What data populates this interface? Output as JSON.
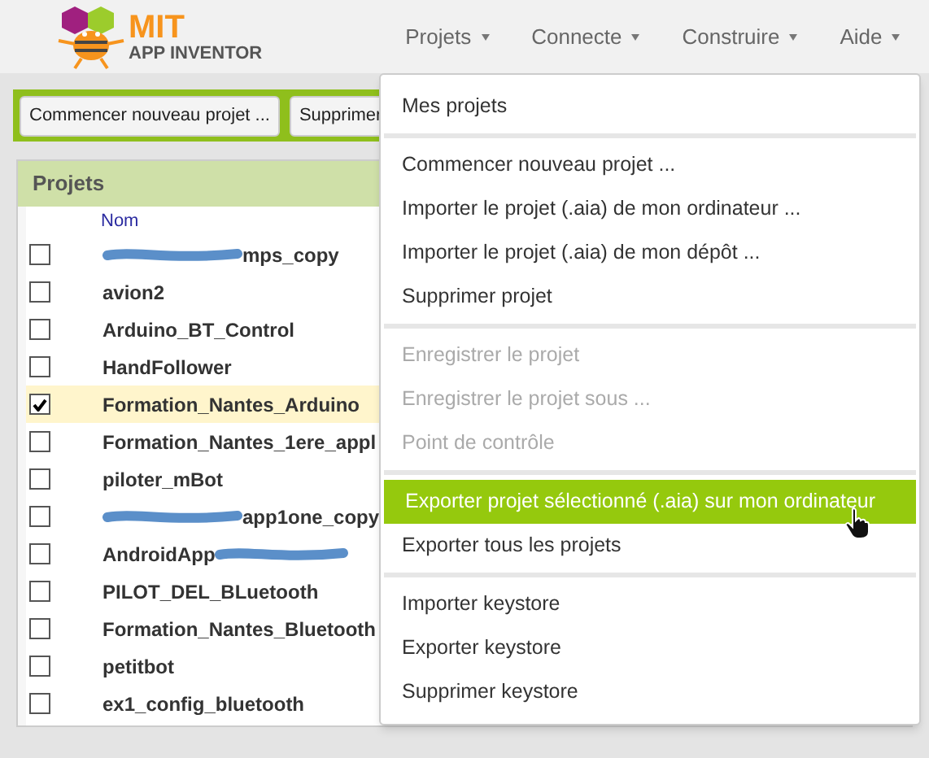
{
  "header": {
    "logo": {
      "title": "MIT",
      "subtitle": "APP INVENTOR"
    },
    "menus": [
      {
        "label": "Projets"
      },
      {
        "label": "Connecte"
      },
      {
        "label": "Construire"
      },
      {
        "label": "Aide"
      }
    ]
  },
  "toolbar": {
    "buttons": [
      "Commencer nouveau projet ...",
      "Supprimer"
    ]
  },
  "projects": {
    "title": "Projets",
    "column": "Nom",
    "rows": [
      {
        "name": "mps_copy",
        "checked": false,
        "kind": "redacted_start"
      },
      {
        "name": "avion2",
        "checked": false,
        "kind": "plain"
      },
      {
        "name": "Arduino_BT_Control",
        "checked": false,
        "kind": "plain"
      },
      {
        "name": "HandFollower",
        "checked": false,
        "kind": "plain"
      },
      {
        "name": "Formation_Nantes_Arduino",
        "checked": true,
        "kind": "plain"
      },
      {
        "name": "Formation_Nantes_1ere_appl",
        "checked": false,
        "kind": "plain"
      },
      {
        "name": "piloter_mBot",
        "checked": false,
        "kind": "plain"
      },
      {
        "name": "app1one_copy",
        "checked": false,
        "kind": "redacted_start"
      },
      {
        "name": "AndroidApp",
        "checked": false,
        "kind": "redacted_end"
      },
      {
        "name": "PILOT_DEL_BLuetooth",
        "checked": false,
        "kind": "plain"
      },
      {
        "name": "Formation_Nantes_Bluetooth",
        "checked": false,
        "kind": "plain"
      },
      {
        "name": "petitbot",
        "checked": false,
        "kind": "plain"
      },
      {
        "name": "ex1_config_bluetooth",
        "checked": false,
        "kind": "plain"
      }
    ]
  },
  "dropdown": {
    "groups": [
      [
        {
          "label": "Mes projets",
          "disabled": false,
          "selected": false
        }
      ],
      [
        {
          "label": "Commencer nouveau projet ...",
          "disabled": false,
          "selected": false
        },
        {
          "label": "Importer le projet (.aia) de mon ordinateur ...",
          "disabled": false,
          "selected": false
        },
        {
          "label": "Importer le projet (.aia) de mon dépôt ...",
          "disabled": false,
          "selected": false
        },
        {
          "label": "Supprimer projet",
          "disabled": false,
          "selected": false
        }
      ],
      [
        {
          "label": "Enregistrer le projet",
          "disabled": true,
          "selected": false
        },
        {
          "label": "Enregistrer le projet sous ...",
          "disabled": true,
          "selected": false
        },
        {
          "label": "Point de contrôle",
          "disabled": true,
          "selected": false
        }
      ],
      [
        {
          "label": "Exporter projet sélectionné (.aia) sur mon ordinateur",
          "disabled": false,
          "selected": true
        },
        {
          "label": "Exporter tous les projets",
          "disabled": false,
          "selected": false
        }
      ],
      [
        {
          "label": "Importer keystore",
          "disabled": false,
          "selected": false
        },
        {
          "label": "Exporter keystore",
          "disabled": false,
          "selected": false
        },
        {
          "label": "Supprimer keystore",
          "disabled": false,
          "selected": false
        }
      ]
    ]
  }
}
